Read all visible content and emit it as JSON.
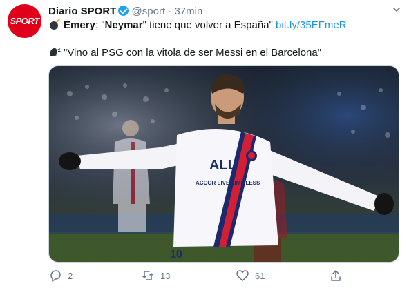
{
  "tweet": {
    "author_name": "Diario SPORT",
    "avatar_text": "SPORT",
    "handle": "@sport",
    "separator": "·",
    "time": "37min",
    "line1_bold1": "Emery",
    "line1_text1": ": \"",
    "line1_bold2": "Neymar",
    "line1_text2": "\" tiene que volver a España\"",
    "link": "bit.ly/35EFmeR",
    "line2_text": "\"Vino al PSG con la vitola de ser Messi en el Barcelona\"",
    "jersey_text": "ACCOR LIVE LIMITLESS",
    "jersey_brand": "ALL",
    "jersey_number": "10"
  },
  "actions": {
    "reply_count": "2",
    "retweet_count": "13",
    "like_count": "61"
  },
  "colors": {
    "brand": "#e1001a",
    "link": "#1b95e0",
    "muted": "#657786",
    "verified": "#1da1f2"
  },
  "icons": [
    "bomb-icon",
    "speaking-head-icon",
    "verified-badge-icon",
    "chevron-down-icon",
    "reply-icon",
    "retweet-icon",
    "like-icon",
    "share-icon"
  ]
}
